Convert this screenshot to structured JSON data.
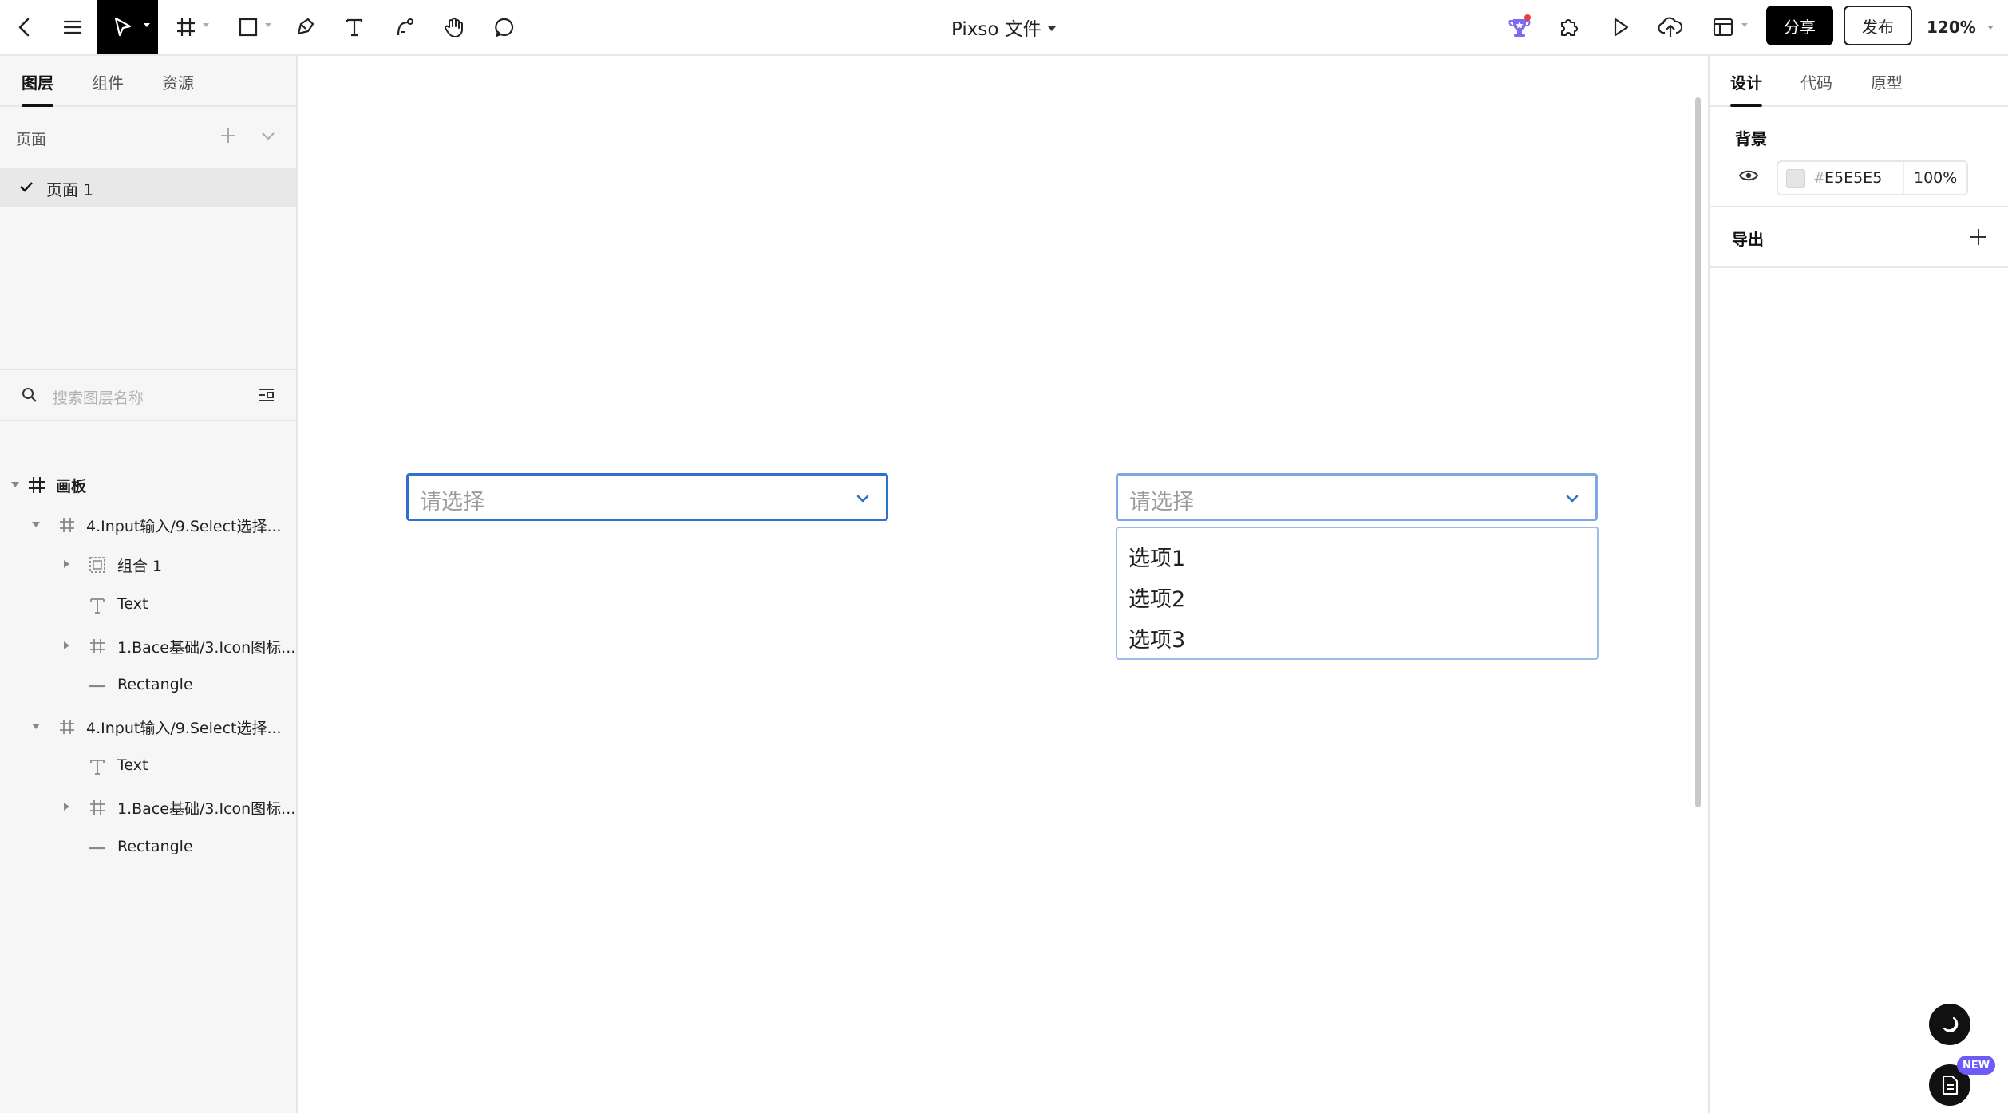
{
  "toolbar": {
    "file_title": "Pixso 文件",
    "share_label": "分享",
    "publish_label": "发布",
    "zoom": "120%",
    "icons": [
      "back-icon",
      "menu-icon",
      "move-tool-icon",
      "frame-tool-icon",
      "rectangle-tool-icon",
      "pen-tool-icon",
      "text-tool-icon",
      "path-tool-icon",
      "hand-tool-icon",
      "comment-tool-icon",
      "trophy-icon",
      "plugin-icon",
      "play-icon",
      "upload-icon",
      "layout-icon"
    ]
  },
  "left_panel": {
    "tabs": [
      "图层",
      "组件",
      "资源"
    ],
    "pages_label": "页面",
    "pages": [
      "页面 1"
    ],
    "search_placeholder": "搜索图层名称",
    "layers": [
      {
        "name": "画板",
        "type": "frame"
      },
      {
        "name": "4.Input输入/9.Select选择...",
        "type": "frame"
      },
      {
        "name": "组合 1",
        "type": "group"
      },
      {
        "name": "Text",
        "type": "text"
      },
      {
        "name": "1.Bace基础/3.Icon图标...",
        "type": "frame"
      },
      {
        "name": "Rectangle",
        "type": "line"
      },
      {
        "name": "4.Input输入/9.Select选择...",
        "type": "frame"
      },
      {
        "name": "Text",
        "type": "text"
      },
      {
        "name": "1.Bace基础/3.Icon图标...",
        "type": "frame"
      },
      {
        "name": "Rectangle",
        "type": "line"
      }
    ]
  },
  "canvas": {
    "select_closed": {
      "placeholder": "请选择"
    },
    "select_open": {
      "placeholder": "请选择",
      "options": [
        "选项1",
        "选项2",
        "选项3"
      ]
    },
    "accent_color": "#2f6fd0"
  },
  "right_panel": {
    "tabs": [
      "设计",
      "代码",
      "原型"
    ],
    "background": {
      "title": "背景",
      "hash": "#",
      "hex": "E5E5E5",
      "opacity": "100%"
    },
    "export": {
      "title": "导出"
    },
    "new_badge": "NEW"
  }
}
